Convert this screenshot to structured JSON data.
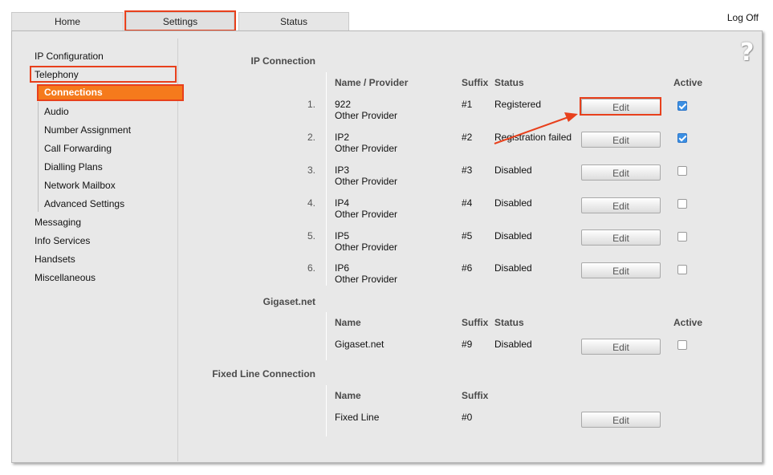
{
  "tabs": {
    "home": "Home",
    "settings": "Settings",
    "status": "Status"
  },
  "logoff": "Log Off",
  "help": "?",
  "sidebar": {
    "ip_configuration": "IP Configuration",
    "telephony": "Telephony",
    "sub": [
      "Connections",
      "Audio",
      "Number Assignment",
      "Call Forwarding",
      "Dialling Plans",
      "Network Mailbox",
      "Advanced Settings"
    ],
    "messaging": "Messaging",
    "info_services": "Info Services",
    "handsets": "Handsets",
    "miscellaneous": "Miscellaneous"
  },
  "ip_section": {
    "title": "IP Connection",
    "headers": {
      "name": "Name / Provider",
      "suffix": "Suffix",
      "status": "Status",
      "active": "Active"
    },
    "rows": [
      {
        "num": "1.",
        "name": "922",
        "provider": "Other Provider",
        "suffix": "#1",
        "status": "Registered",
        "edit": "Edit",
        "active": true
      },
      {
        "num": "2.",
        "name": "IP2",
        "provider": "Other Provider",
        "suffix": "#2",
        "status": "Registration failed",
        "edit": "Edit",
        "active": true
      },
      {
        "num": "3.",
        "name": "IP3",
        "provider": "Other Provider",
        "suffix": "#3",
        "status": "Disabled",
        "edit": "Edit",
        "active": false
      },
      {
        "num": "4.",
        "name": "IP4",
        "provider": "Other Provider",
        "suffix": "#4",
        "status": "Disabled",
        "edit": "Edit",
        "active": false
      },
      {
        "num": "5.",
        "name": "IP5",
        "provider": "Other Provider",
        "suffix": "#5",
        "status": "Disabled",
        "edit": "Edit",
        "active": false
      },
      {
        "num": "6.",
        "name": "IP6",
        "provider": "Other Provider",
        "suffix": "#6",
        "status": "Disabled",
        "edit": "Edit",
        "active": false
      }
    ]
  },
  "gigaset_section": {
    "title": "Gigaset.net",
    "headers": {
      "name": "Name",
      "suffix": "Suffix",
      "status": "Status",
      "active": "Active"
    },
    "row": {
      "name": "Gigaset.net",
      "suffix": "#9",
      "status": "Disabled",
      "edit": "Edit",
      "active": false
    }
  },
  "fixed_section": {
    "title": "Fixed Line Connection",
    "headers": {
      "name": "Name",
      "suffix": "Suffix"
    },
    "row": {
      "name": "Fixed Line",
      "suffix": "#0",
      "edit": "Edit"
    }
  },
  "colors": {
    "highlight": "#e8401c",
    "active_nav": "#f57a1c",
    "checkbox_checked": "#3b8fe3"
  }
}
